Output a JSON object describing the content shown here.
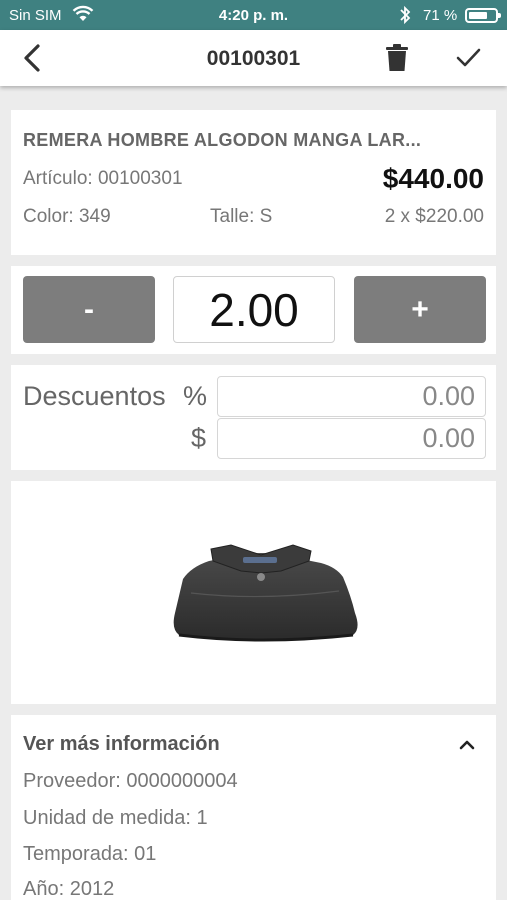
{
  "status_bar": {
    "carrier": "Sin SIM",
    "time": "4:20 p. m.",
    "battery_text": "71 %",
    "battery_level": 0.71,
    "wifi_icon": "wifi-icon",
    "bluetooth_icon": "bluetooth-icon"
  },
  "nav": {
    "title": "00100301",
    "back_icon": "chevron-left-icon",
    "delete_icon": "trash-icon",
    "confirm_icon": "checkmark-icon"
  },
  "product": {
    "name": "REMERA HOMBRE ALGODON MANGA LAR...",
    "article": "Artículo: 00100301",
    "total_price": "$440.00",
    "color": "Color: 349",
    "size": "Talle: S",
    "unit_line": "2 x $220.00"
  },
  "quantity": {
    "minus_label": "-",
    "value": "2.00",
    "plus_label": "+"
  },
  "discounts": {
    "label": "Descuentos",
    "percent_symbol": "%",
    "percent_value": "0.00",
    "amount_symbol": "$",
    "amount_value": "0.00"
  },
  "image": {
    "icon": "shirt-image"
  },
  "more_info": {
    "header": "Ver más información",
    "collapse_icon": "chevron-up-icon",
    "rows": [
      "Proveedor: 0000000004",
      "Unidad de medida: 1",
      "Temporada: 01",
      "Año: 2012"
    ]
  },
  "colors": {
    "status_bar_bg": "#3f8181",
    "button_gray": "#7d7d7d",
    "page_bg": "#ececec"
  }
}
